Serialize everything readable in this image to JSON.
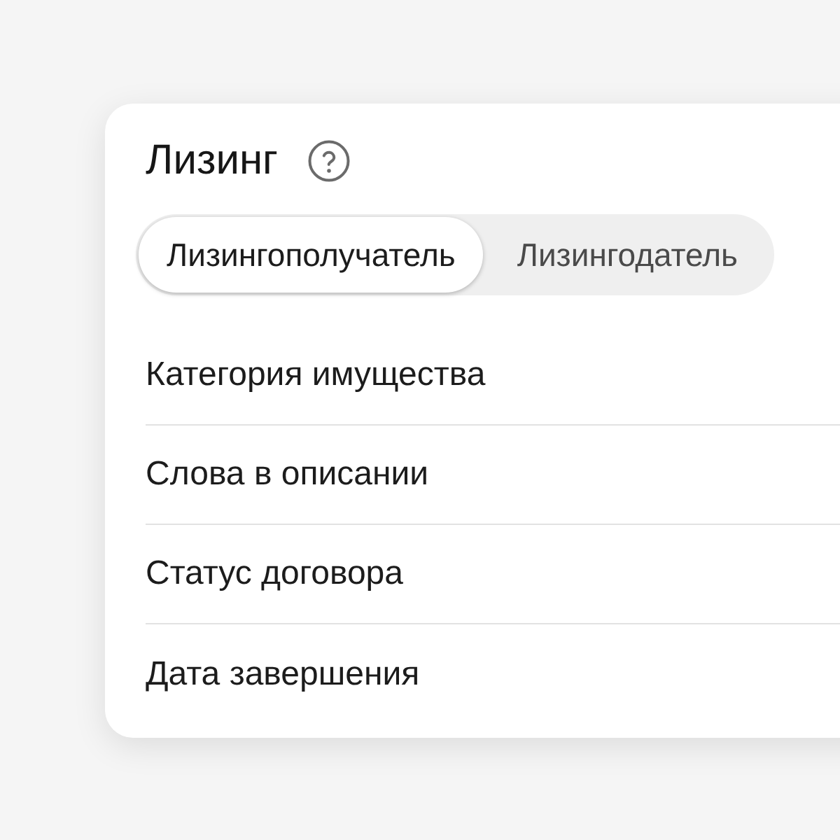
{
  "panel": {
    "title": "Лизинг"
  },
  "tabs": [
    {
      "label": "Лизингополучатель",
      "selected": true
    },
    {
      "label": "Лизингодатель",
      "selected": false
    }
  ],
  "filters": [
    {
      "label": "Категория имущества"
    },
    {
      "label": "Слова в описании"
    },
    {
      "label": "Статус договора"
    },
    {
      "label": "Дата завершения"
    }
  ]
}
